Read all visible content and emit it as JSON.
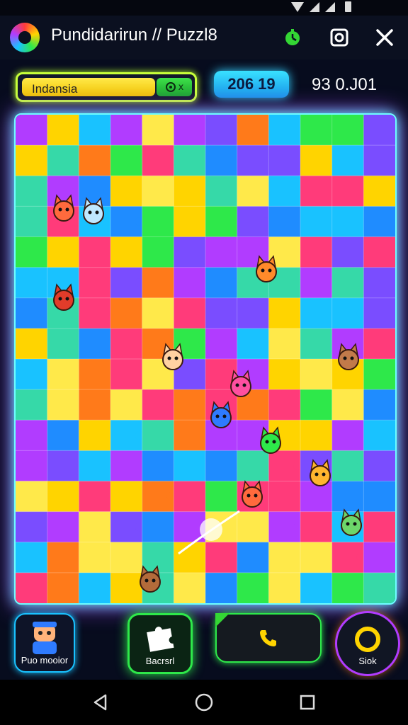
{
  "app": {
    "title": "Pundidarirun // Puzzl8"
  },
  "status_bar": {
    "icons": [
      "wifi-icon",
      "signal-icon",
      "signal-icon",
      "battery-icon"
    ]
  },
  "toolbar": {
    "timer_icon": "timer-icon",
    "record_icon": "record-icon",
    "close_icon": "close-icon"
  },
  "hud": {
    "player_name": "Indansia",
    "badge_text": "x",
    "level": "206 19",
    "score": "93 0.J01"
  },
  "board": {
    "colors": [
      "#19c2ff",
      "#2ee84a",
      "#ffd400",
      "#ff3b7a",
      "#b13cff",
      "#ff7a1a",
      "#7a4dff",
      "#ffe94a",
      "#1f8cff",
      "#36d9a8"
    ],
    "characters": [
      "fox-character",
      "red-panda-character",
      "cat-character",
      "fox-character",
      "dog-character",
      "bunny-character",
      "dragon-character",
      "parrot-character",
      "fox-character",
      "owl-character",
      "mushroom-character",
      "bear-character",
      "ghost-character"
    ],
    "sparkle": "sparkle-effect"
  },
  "controls": {
    "left_label": "Puo mooior",
    "center_label": "Bacrsrl",
    "phone_icon": "phone-icon",
    "right_label": "Siok"
  },
  "nav": {
    "back_icon": "back-icon",
    "home_icon": "home-icon",
    "recents_icon": "recents-icon"
  }
}
